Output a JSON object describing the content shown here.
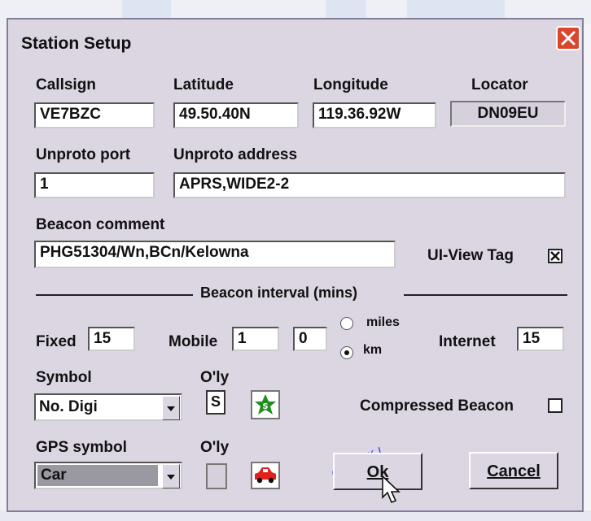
{
  "window": {
    "title": "Station Setup"
  },
  "station": {
    "callsign_label": "Callsign",
    "callsign_value": "VE7BZC",
    "latitude_label": "Latitude",
    "latitude_value": "49.50.40N",
    "longitude_label": "Longitude",
    "longitude_value": "119.36.92W",
    "locator_label": "Locator",
    "locator_value": "DN09EU"
  },
  "unproto": {
    "port_label": "Unproto port",
    "port_value": "1",
    "address_label": "Unproto address",
    "address_value": "APRS,WIDE2-2"
  },
  "beacon": {
    "comment_label": "Beacon comment",
    "comment_value": "PHG51304/Wn,BCn/Kelowna",
    "uiview_tag_label": "UI-View Tag",
    "uiview_tag_checked": true
  },
  "interval": {
    "section_label": "Beacon interval (mins)",
    "fixed_label": "Fixed",
    "fixed_value": "15",
    "mobile_label": "Mobile",
    "mobile_value1": "1",
    "mobile_value2": "0",
    "miles_label": "miles",
    "km_label": "km",
    "unit_selected": "km",
    "internet_label": "Internet",
    "internet_value": "15"
  },
  "symbol": {
    "label": "Symbol",
    "overlay_label": "O'ly",
    "value": "No. Digi",
    "overlay_value": "S"
  },
  "compressed": {
    "label": "Compressed Beacon",
    "checked": false
  },
  "gps_symbol": {
    "label": "GPS symbol",
    "overlay_label": "O'ly",
    "value": "Car",
    "overlay_value": ""
  },
  "buttons": {
    "ok_label": "Ok",
    "cancel_label": "Cancel"
  },
  "annotation": {
    "hint": "Click OK !"
  },
  "colors": {
    "dialog_bg": "#dcd6e2",
    "close_red": "#d9482c",
    "hint_blue": "#3a3ae8",
    "digi_green": "#1e8f1e",
    "car_red": "#e0201a"
  },
  "icons": {
    "close": "close-icon",
    "symbol": "digipeater-star-icon",
    "gps_symbol": "car-icon"
  }
}
